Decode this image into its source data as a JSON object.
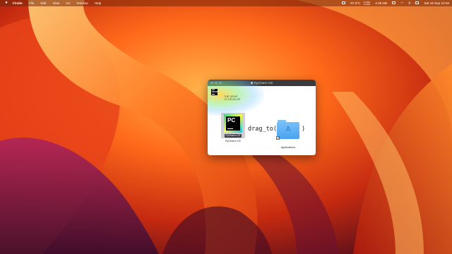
{
  "menubar": {
    "apple": "",
    "app_name": "Finder",
    "items": [
      "File",
      "Edit",
      "View",
      "Go",
      "Window",
      "Help"
    ],
    "status": {
      "temp": "67.0°C",
      "net_up": "0.2 KB/s",
      "net_down": "1.5 KB/s",
      "memory": "4.28 GB",
      "clock": "Sat 16 Sep 12:03"
    }
  },
  "window": {
    "title": "PyCharm CE",
    "brand_logo": "JET BRAINS",
    "slogan_line1": "THE DRIVE",
    "slogan_line2": "TO DEVELOP",
    "app_icon_letters": "PC",
    "app_badge": "PyCharm CE",
    "app_label": "PyCharm CE",
    "drag_text": "drag_to(",
    "close_paren": ")",
    "folder_label": "Applications",
    "folder_glyph": "A"
  }
}
